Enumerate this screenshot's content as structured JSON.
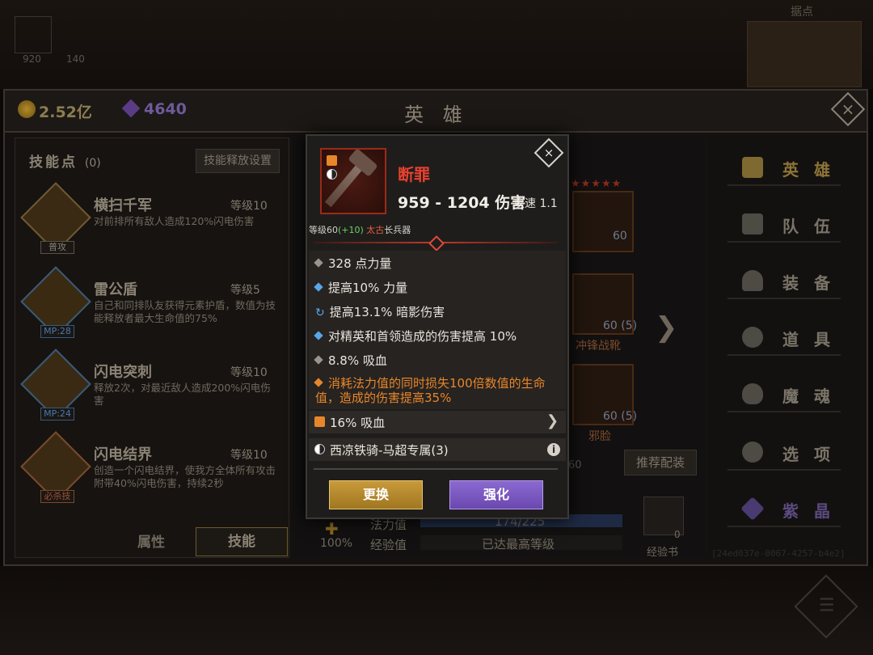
{
  "header": {
    "title": "英 雄",
    "gold": "2.52亿",
    "gems": "4640",
    "close": "×"
  },
  "top_hud": {
    "left_a": "920",
    "left_b": "140",
    "right_label": "据点"
  },
  "skills": {
    "title": "技能点",
    "points": "(0)",
    "release_settings": "技能释放设置",
    "items": [
      {
        "name": "横扫千军",
        "level": "等级10",
        "tag": "普攻",
        "desc": "对前排所有敌人造成120%闪电伤害"
      },
      {
        "name": "雷公盾",
        "level": "等级5",
        "tag": "MP:28",
        "desc": "自己和同排队友获得元素护盾，数值为技能释放者最大生命值的75%"
      },
      {
        "name": "闪电突刺",
        "level": "等级10",
        "tag": "MP:24",
        "desc": "释放2次，对最近敌人造成200%闪电伤害"
      },
      {
        "name": "闪电结界",
        "level": "等级10",
        "tag": "必杀技",
        "desc": "创造一个闪电结界，使我方全体所有攻击附带40%闪电伤害，持续2秒"
      }
    ],
    "tab_attr": "属性",
    "tab_skill": "技能"
  },
  "middle": {
    "eq1_level": "60",
    "eq2_level": "60",
    "eq2_plus": "(5)",
    "eq2_name": "冲锋战靴",
    "eq3_level": "60",
    "eq3_plus": "(5)",
    "eq3_name": "邪脸",
    "partial_60": "60",
    "recommend": "推荐配装",
    "mana_label": "法力值",
    "mana_value": "174/225",
    "exp_label": "经验值",
    "exp_value": "已达最高等级",
    "percent": "100%",
    "book_label": "经验书",
    "book_count": "0"
  },
  "menu": [
    {
      "label": "英 雄",
      "icon": "hero-icon"
    },
    {
      "label": "队 伍",
      "icon": "flag-icon"
    },
    {
      "label": "装 备",
      "icon": "helmet-icon"
    },
    {
      "label": "道 具",
      "icon": "bag-icon"
    },
    {
      "label": "魔 魂",
      "icon": "flame-icon"
    },
    {
      "label": "选 项",
      "icon": "gear-icon"
    },
    {
      "label": "紫 晶",
      "icon": "crystal-icon"
    }
  ],
  "uuid": "[24ed037e-0067-4257-b4e2]",
  "weapon": {
    "name": "断罪",
    "damage": "959 - 1204 伤害",
    "speed": "攻速 1.1",
    "level_prefix": "等级60",
    "level_bonus": "(+10)",
    "rarity": "太古",
    "type": "长兵器",
    "attrs": [
      "328 点力量",
      "提高10% 力量",
      "提高13.1% 暗影伤害",
      "对精英和首领造成的伤害提高 10%",
      "8.8% 吸血",
      "消耗法力值的同时损失100倍数值的生命值，造成的伤害提高35%"
    ],
    "gem_row": "16% 吸血",
    "set_row": "西凉铁骑-马超专属(3)",
    "btn_swap": "更换",
    "btn_upgrade": "强化"
  }
}
